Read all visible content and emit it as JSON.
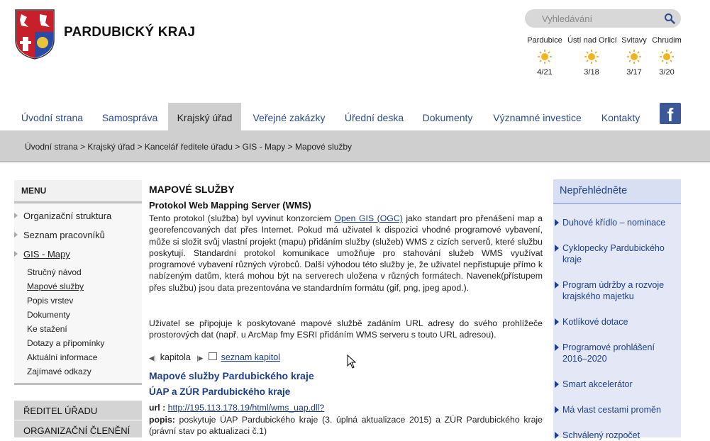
{
  "header": {
    "site_title": "PARDUBICKÝ KRAJ",
    "search_placeholder": "Vyhledávání",
    "weather": [
      {
        "city": "Pardubice",
        "temp": "4/21",
        "icon": "sun-icon"
      },
      {
        "city": "Ústí nad Orlicí",
        "temp": "3/18",
        "icon": "sun-icon"
      },
      {
        "city": "Svitavy",
        "temp": "3/17",
        "icon": "sun-icon"
      },
      {
        "city": "Chrudim",
        "temp": "3/20",
        "icon": "sun-icon"
      }
    ]
  },
  "nav": {
    "items": [
      {
        "label": "Úvodní strana"
      },
      {
        "label": "Samospráva"
      },
      {
        "label": "Krajský úřad",
        "active": true
      },
      {
        "label": "Veřejné zakázky"
      },
      {
        "label": "Úřední deska"
      },
      {
        "label": "Dokumenty"
      },
      {
        "label": "Významné investice"
      },
      {
        "label": "Kontakty"
      }
    ],
    "facebook_icon": "facebook-icon"
  },
  "breadcrumb": {
    "items": [
      "Úvodní strana",
      "Krajský úřad",
      "Kancelář ředitele úřadu",
      "GIS - Mapy",
      "Mapové služby"
    ],
    "separator": ">"
  },
  "menu": {
    "title": "MENU",
    "items": [
      {
        "label": "Organizační struktura"
      },
      {
        "label": "Seznam pracovníků"
      },
      {
        "label": "GIS - Mapy"
      }
    ],
    "subitems": [
      {
        "label": "Stručný návod"
      },
      {
        "label": "Mapové služby",
        "current": true
      },
      {
        "label": "Popis vrstev"
      },
      {
        "label": "Dokumenty"
      },
      {
        "label": "Ke stažení"
      },
      {
        "label": "Dotazy a připomínky"
      },
      {
        "label": "Aktuální informace"
      },
      {
        "label": "Zajímavé odkazy"
      }
    ],
    "sections": [
      {
        "label": "ŘEDITEL ÚŘADU"
      },
      {
        "label": "ORGANIZAČNÍ ČLENĚNÍ"
      }
    ]
  },
  "content": {
    "title": "MAPOVÉ SLUŽBY",
    "subtitle": "Protokol Web Mapping Server (WMS)",
    "para1_before": "Tento protokol (služba) byl vyvinut konzorciem ",
    "para1_link": "Open GIS (OGC)",
    "para1_after": " jako standart pro přenášení map a georefencovaných dat přes Internet. Pokud má uživatel k dispozici vhodné programové vybavení, může si složit svůj vlastní projekt (mapu)  přidáním služby (služeb) WMS z cizích serverů, které službu poskytují. Standardní protokol komunikace umožňuje pro stahování služeb WMS využívat programové vybavení různých výrobců. Další výhodou této služby je, že uživatel nepřistupuje přímo k nabízeným datům, která mohou být na serverech uložena v různých formátech. Navenek(přístupem přes službu) jsou data prezentována ve standardním formátu (gif, png, jpeg apod.).",
    "para2": "Uživatel se připojuje k poskytované mapové službě zadáním URL adresy do svého prohlížeče prostorových dat (např. u ArcMap fmy ESRI přidáním WMS serveru s touto URL adresou).",
    "chapter_label": "kapitola",
    "chapter_list_link": "seznam kapitol",
    "section_title": "Mapové služby Pardubického kraje",
    "sub_title": "ÚAP a ZÚR Pardubického kraje",
    "url_label": "url :",
    "url_value": "http://195.113.178.19/html/wms_uap.dll?",
    "popis_label": "popis:",
    "popis_text": " poskytuje ÚAP Pardubického kraje (3. úplná aktualizace 2015) a ZÚR Pardubického kraje (právní stav po aktualizaci č.1)"
  },
  "sidebar_right": {
    "title": "Nepřehlédněte",
    "items": [
      {
        "label": "Duhové křídlo – nominace"
      },
      {
        "label": "Cyklopecky Pardubického kraje"
      },
      {
        "label": "Program údržby a rozvoje krajského majetku"
      },
      {
        "label": "Kotlíkové dotace"
      },
      {
        "label": "Programové prohlášení 2016–2020"
      },
      {
        "label": "Smart akcelerátor"
      },
      {
        "label": "Má vlast cestami proměn"
      },
      {
        "label": "Schválený rozpočet"
      }
    ]
  },
  "colors": {
    "nav_link": "#2a4a8a",
    "accent_blue": "#1d3f8c",
    "gray_bar": "#cfcfcf",
    "right_panel": "#e4e8f6",
    "facebook": "#3b5998"
  }
}
